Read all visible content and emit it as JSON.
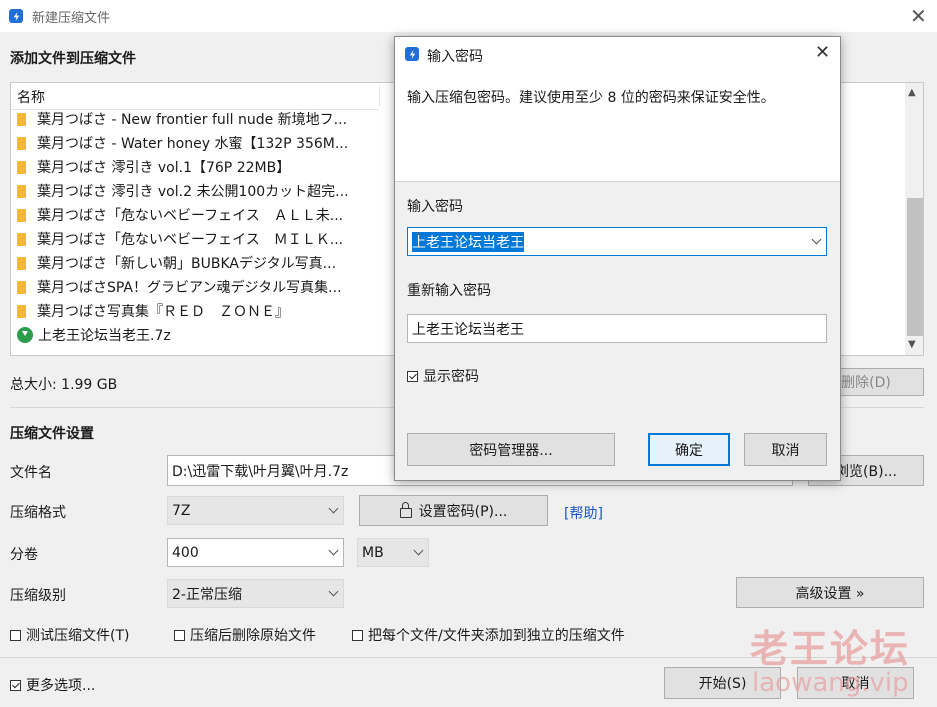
{
  "window": {
    "title": "新建压缩文件",
    "close_glyph": "✕",
    "icon": "app-logo-icon"
  },
  "files_section": {
    "title": "添加文件到压缩文件",
    "column_name": "名称",
    "items": [
      {
        "name": "葉月つばさ - New frontier full nude 新境地フ...",
        "icon": "folder-icon"
      },
      {
        "name": "葉月つばさ - Water honey 水蜜【132P 356M...",
        "icon": "folder-icon"
      },
      {
        "name": "葉月つばさ 澪引き vol.1【76P 22MB】",
        "icon": "folder-icon"
      },
      {
        "name": "葉月つばさ 澪引き vol.2 未公開100カット超完...",
        "icon": "folder-icon"
      },
      {
        "name": "葉月つばさ「危ないベビーフェイス　ＡＬＬ未...",
        "icon": "folder-icon"
      },
      {
        "name": "葉月つばさ「危ないベビーフェイス　ＭＩＬＫ...",
        "icon": "folder-icon"
      },
      {
        "name": "葉月つばさ「新しい朝」BUBKAデジタル写真...",
        "icon": "folder-icon"
      },
      {
        "name": "葉月つばさSPA！グラビアン魂デジタル写真集...",
        "icon": "folder-icon"
      },
      {
        "name": "葉月つばさ写真集『ＲＥＤ　ＺＯＮＥ』",
        "icon": "folder-icon"
      },
      {
        "name": "上老王论坛当老王.7z",
        "icon": "7z-archive-icon"
      }
    ],
    "total_size": "总大小: 1.99 GB",
    "delete_button": "删除(D)"
  },
  "settings": {
    "title": "压缩文件设置",
    "filename_label": "文件名",
    "filename_value": "D:\\迅雷下载\\叶月翼\\叶月.7z",
    "browse_button": "浏览(B)...",
    "format_label": "压缩格式",
    "format_value": "7Z",
    "set_password_button": "设置密码(P)...",
    "help_link": "[帮助]",
    "split_label": "分卷",
    "split_value": "400",
    "split_unit": "MB",
    "level_label": "压缩级别",
    "level_value": "2-正常压缩",
    "advanced_button": "高级设置 »",
    "opt_test": "测试压缩文件(T)",
    "opt_delete": "压缩后删除原始文件",
    "opt_separate": "把每个文件/文件夹添加到独立的压缩文件",
    "more_options": "更多选项...",
    "start_button": "开始(S)",
    "cancel_button": "取消"
  },
  "dialog": {
    "title": "输入密码",
    "info": "输入压缩包密码。建议使用至少 8 位的密码来保证安全性。",
    "password_label": "输入密码",
    "password_value": "上老王论坛当老王",
    "reenter_label": "重新输入密码",
    "reenter_value": "上老王论坛当老王",
    "show_password": "显示密码",
    "manager_button": "密码管理器...",
    "ok_button": "确定",
    "cancel_button": "取消"
  },
  "watermark": {
    "main": "老王论坛",
    "sub": "laowang.vip",
    "color": "#e8a0a0"
  }
}
